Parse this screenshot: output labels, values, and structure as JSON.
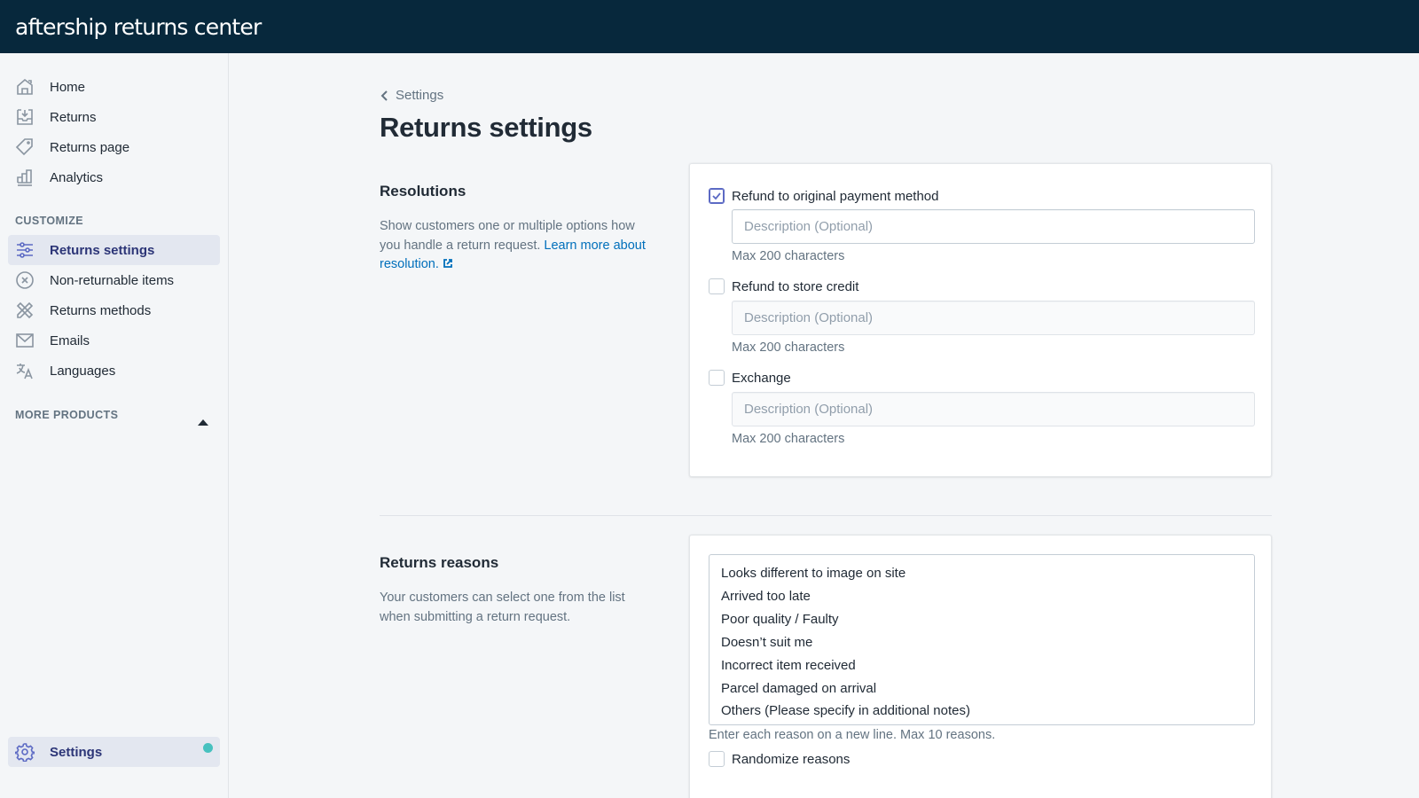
{
  "app": {
    "logo_text": "aftership returns center"
  },
  "sidebar": {
    "main_items": [
      {
        "label": "Home",
        "icon": "home-icon"
      },
      {
        "label": "Returns",
        "icon": "inbox-download-icon"
      },
      {
        "label": "Returns page",
        "icon": "tag-icon"
      },
      {
        "label": "Analytics",
        "icon": "bar-chart-icon"
      }
    ],
    "customize_label": "CUSTOMIZE",
    "customize_items": [
      {
        "label": "Returns settings",
        "icon": "sliders-icon",
        "active": true
      },
      {
        "label": "Non-returnable items",
        "icon": "circle-x-icon"
      },
      {
        "label": "Returns methods",
        "icon": "pencil-ruler-icon"
      },
      {
        "label": "Emails",
        "icon": "envelope-icon"
      },
      {
        "label": "Languages",
        "icon": "translate-icon"
      }
    ],
    "more_products_label": "MORE PRODUCTS",
    "settings": {
      "label": "Settings",
      "icon": "gear-icon",
      "status_color": "#47c1bf"
    }
  },
  "page": {
    "breadcrumb": "Settings",
    "title": "Returns settings"
  },
  "resolutions": {
    "title": "Resolutions",
    "description": "Show customers one or multiple options how you handle a return request. ",
    "link_text": "Learn more about resolution.",
    "options": [
      {
        "label": "Refund to original payment method",
        "checked": true,
        "placeholder": "Description (Optional)",
        "value": "",
        "helper": "Max 200 characters"
      },
      {
        "label": "Refund to store credit",
        "checked": false,
        "placeholder": "Description (Optional)",
        "value": "",
        "helper": "Max 200 characters"
      },
      {
        "label": "Exchange",
        "checked": false,
        "placeholder": "Description (Optional)",
        "value": "",
        "helper": "Max 200 characters"
      }
    ]
  },
  "reasons": {
    "title": "Returns reasons",
    "description": "Your customers can select one from the list when submitting a return request.",
    "list": [
      "Looks different to image on site",
      "Arrived too late",
      "Poor quality / Faulty",
      "Doesn’t suit me",
      "Incorrect item received",
      "Parcel damaged on arrival",
      "Others (Please specify in additional notes)"
    ],
    "helper": "Enter each reason on a new line. Max 10 reasons.",
    "randomize_label": "Randomize reasons",
    "randomize_checked": false
  },
  "colors": {
    "topbar": "#07283c",
    "accent": "#5c6ac4",
    "link": "#006fbb",
    "active_nav_bg": "#e3e7f0"
  }
}
